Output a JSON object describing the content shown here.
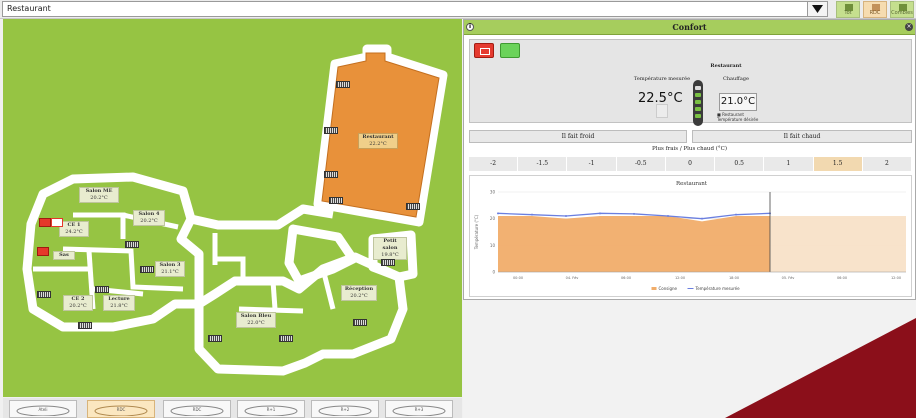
{
  "topbar": {
    "room_select_value": "Restaurant",
    "buttons": [
      {
        "label": "Tot"
      },
      {
        "label": "RDC"
      },
      {
        "label": "Combles"
      }
    ]
  },
  "plan": {
    "rooms": [
      {
        "name": "Restaurant",
        "temp": "22.2°C",
        "style": "orange"
      },
      {
        "name": "Salon ME",
        "temp": "20.2°C"
      },
      {
        "name": "Salon 4",
        "temp": "20.2°C"
      },
      {
        "name": "CE 1",
        "temp": "24.2°C"
      },
      {
        "name": "Salon 3",
        "temp": "21.1°C"
      },
      {
        "name": "CE 2",
        "temp": "20.2°C"
      },
      {
        "name": "Lecture",
        "temp": "21.8°C"
      },
      {
        "name": "Salon Bleu",
        "temp": "22.0°C"
      },
      {
        "name": "Réception",
        "temp": "20.2°C"
      },
      {
        "name": "Petit salon",
        "temp": "19.8°C"
      },
      {
        "name": "Sas",
        "temp": ""
      }
    ]
  },
  "thumbnails": [
    {
      "label": "Ateli"
    },
    {
      "label": "RDC"
    },
    {
      "label": "RDC"
    },
    {
      "label": "R+1"
    },
    {
      "label": "R+2"
    },
    {
      "label": "R+3"
    }
  ],
  "panel": {
    "title": "Confort",
    "info_icon": "i",
    "close_icon": "×",
    "room_name": "Restaurant",
    "measured_label": "Température mesurée",
    "measured_value": "22.5°C",
    "heating_label": "Chauffage",
    "set_value": "21.0°C",
    "set_note_1": "Restaurant",
    "set_note_2": "Température désirée",
    "btn_cold": "Il fait froid",
    "btn_hot": "Il fait chaud",
    "adjust_label": "Plus frais / Plus chaud (°C)",
    "adjust_options": [
      "-2",
      "-1.5",
      "-1",
      "-0.5",
      "0",
      "0.5",
      "1",
      "1.5",
      "2"
    ],
    "adjust_selected": "1.5"
  },
  "colors": {
    "plan_green": "#96c443",
    "accent_orange": "#e8913a",
    "alert_red": "#e5382a",
    "panel_header": "#a6cd5d",
    "maroon": "#8b0f1a"
  },
  "chart_data": {
    "type": "area",
    "title": "Restaurant",
    "ylabel": "Température (°C)",
    "ylim": [
      0,
      30
    ],
    "yticks": [
      0,
      10,
      20,
      30
    ],
    "x": [
      "00:00",
      "06:00",
      "12:00",
      "18:00",
      "00:00",
      "06:00",
      "12:00",
      "18:00",
      "00:00",
      "06:00",
      "12:00",
      "18:00",
      "00:00"
    ],
    "x_tick_labels": [
      "00:00",
      "04. Fév",
      "06:00",
      "12:00",
      "18:00",
      "05. Fév",
      "06:00",
      "12:00"
    ],
    "series": [
      {
        "name": "Consigne",
        "kind": "area",
        "color": "#f1ad6a",
        "values": [
          21,
          21,
          20,
          21,
          21,
          21,
          19,
          21,
          21,
          21,
          21,
          21,
          21
        ]
      },
      {
        "name": "Température mesurée",
        "kind": "line",
        "color": "#6b7fe0",
        "values": [
          22,
          21.5,
          21,
          22,
          21.8,
          21,
          20,
          21.5,
          22,
          null,
          null,
          null,
          null
        ]
      }
    ],
    "now_index": 8,
    "legend": "bottom-center"
  }
}
